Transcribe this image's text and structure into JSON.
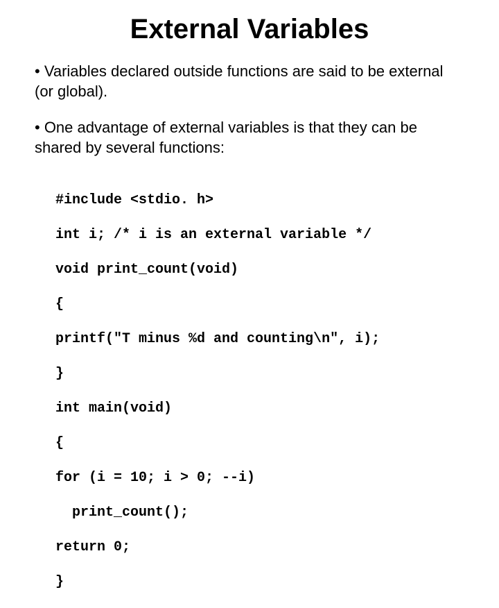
{
  "title": "External Variables",
  "bullets": [
    "• Variables declared outside functions are said to be external (or global).",
    "• One advantage of external variables is that they can be shared by several functions:"
  ],
  "code_lines": [
    "#include <stdio. h>",
    "int i; /* i is an external variable */",
    "void print_count(void)",
    "{",
    "printf(\"T minus %d and counting\\n\", i);",
    "}",
    "int main(void)",
    "{",
    "for (i = 10; i > 0; --i)",
    "  print_count();",
    "return 0;",
    "}"
  ]
}
